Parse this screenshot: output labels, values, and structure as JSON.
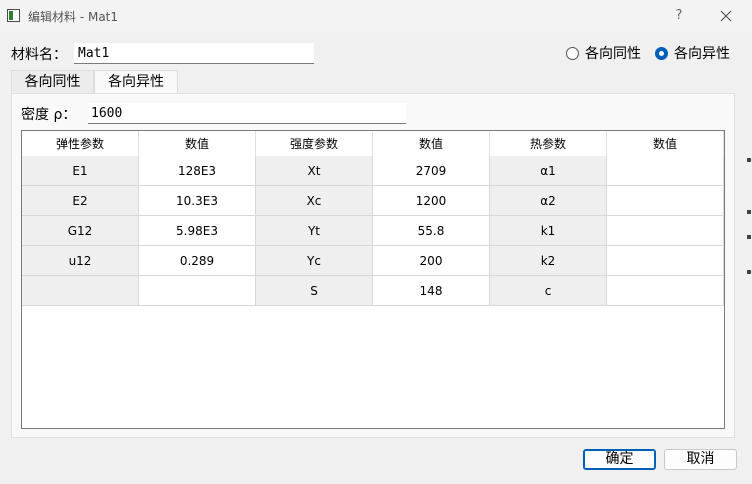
{
  "window": {
    "title": "编辑材料 - Mat1",
    "help": "?"
  },
  "material_name": {
    "label": "材料名：",
    "value": "Mat1"
  },
  "material_type": {
    "options": [
      {
        "label": "各向同性",
        "checked": false
      },
      {
        "label": "各向异性",
        "checked": true
      }
    ]
  },
  "tabs": [
    {
      "label": "各向同性",
      "active": false
    },
    {
      "label": "各向异性",
      "active": true
    }
  ],
  "density": {
    "label": "密度 ρ：",
    "value": "1600"
  },
  "table": {
    "headers": [
      "弹性参数",
      "数值",
      "强度参数",
      "数值",
      "热参数",
      "数值"
    ],
    "rows": [
      [
        "E1",
        "128E3",
        "Xt",
        "2709",
        "α1",
        ""
      ],
      [
        "E2",
        "10.3E3",
        "Xc",
        "1200",
        "α2",
        ""
      ],
      [
        "G12",
        "5.98E3",
        "Yt",
        "55.8",
        "k1",
        ""
      ],
      [
        "u12",
        "0.289",
        "Yc",
        "200",
        "k2",
        ""
      ],
      [
        "",
        "",
        "S",
        "148",
        "c",
        ""
      ]
    ]
  },
  "buttons": {
    "ok": "确定",
    "cancel": "取消"
  },
  "colors": {
    "accent": "#005fb8",
    "param_cell_bg": "#efefef"
  }
}
